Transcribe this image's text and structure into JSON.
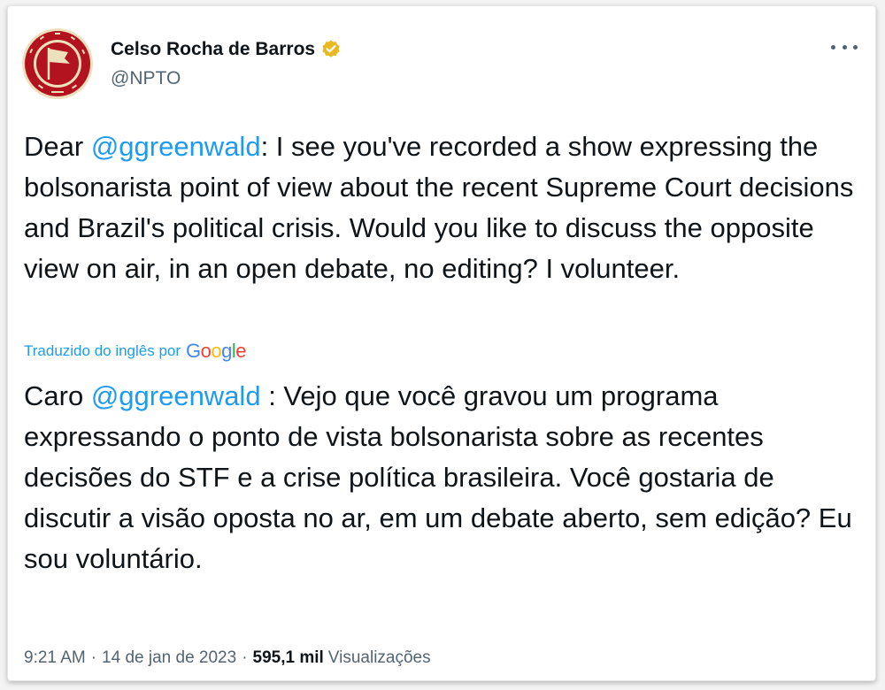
{
  "author": {
    "name": "Celso Rocha de Barros",
    "handle": "@NPTO",
    "avatar_text": "SMASH THE BRITISH NATIONAL JON ELSTER",
    "verified_color": "#f4c430"
  },
  "tweet": {
    "greeting": "Dear ",
    "mention": "@ggreenwald",
    "body": ": I see you've recorded a show expressing the bolsonarista point of view about the recent Supreme Court decisions and Brazil's political crisis. Would you like to discuss the opposite view on air, in an open debate, no editing? I volunteer."
  },
  "translation": {
    "label": "Traduzido do inglês por",
    "provider": "Google",
    "provider_colors": [
      "#4285f4",
      "#ea4335",
      "#fbbc05",
      "#4285f4",
      "#34a853",
      "#ea4335"
    ],
    "greeting": "Caro ",
    "mention": "@ggreenwald",
    "body": " : Vejo que você gravou um programa expressando o ponto de vista bolsonarista sobre as recentes decisões do STF e a crise política brasileira. Você gostaria de discutir a visão oposta no ar, em um debate aberto, sem edição? Eu sou voluntário."
  },
  "meta": {
    "time": "9:21 AM",
    "separator": "·",
    "date": "14 de jan de 2023",
    "views_count": "595,1 mil",
    "views_label": "Visualizações"
  },
  "colors": {
    "link": "#1d9bf0",
    "secondary_text": "#536471",
    "primary_text": "#0f1419",
    "avatar_red": "#c8102e",
    "avatar_cream": "#f2e6c4"
  },
  "icons": {
    "more": "more-horizontal-icon",
    "verified": "verified-badge-icon"
  }
}
